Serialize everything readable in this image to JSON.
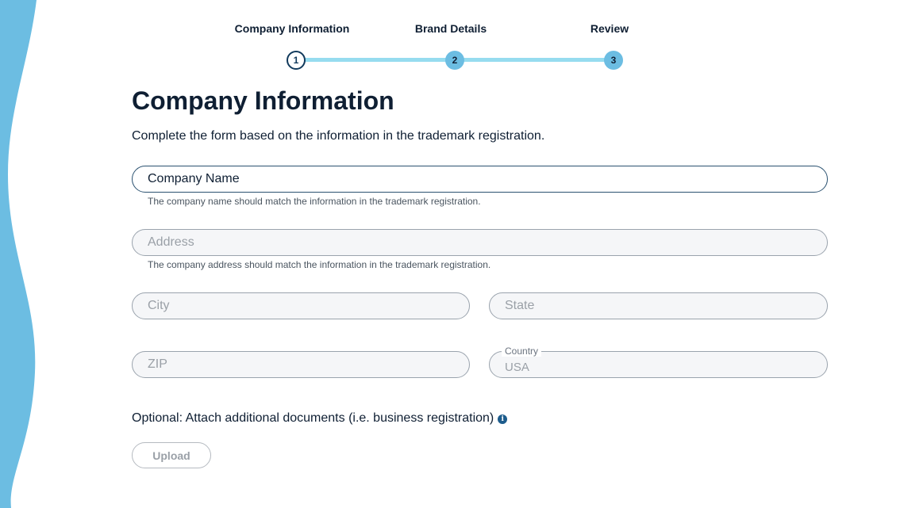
{
  "stepper": {
    "steps": [
      {
        "label": "Company Information",
        "number": "1",
        "state": "active"
      },
      {
        "label": "Brand Details",
        "number": "2",
        "state": "upcoming"
      },
      {
        "label": "Review",
        "number": "3",
        "state": "upcoming"
      }
    ]
  },
  "form": {
    "title": "Company Information",
    "intro": "Complete the form based on the information in the trademark registration.",
    "company_name": {
      "placeholder": "Company Name",
      "value": "",
      "helper": "The company name should match the information in the trademark registration."
    },
    "address": {
      "placeholder": "Address",
      "value": "",
      "helper": "The company address should match the information in the trademark registration."
    },
    "city": {
      "placeholder": "City",
      "value": ""
    },
    "state": {
      "placeholder": "State",
      "value": ""
    },
    "zip": {
      "placeholder": "ZIP",
      "value": ""
    },
    "country": {
      "label": "Country",
      "value": "USA"
    },
    "optional_text": "Optional: Attach additional documents (i.e. business registration)",
    "info_icon_glyph": "i",
    "upload_label": "Upload"
  },
  "colors": {
    "wave": "#6cbde2",
    "step_track": "#96dcef",
    "step_active_border": "#123a5c",
    "heading": "#0f1f33",
    "info_icon": "#1d5c8c"
  },
  "icons": {
    "info": "info-icon"
  }
}
